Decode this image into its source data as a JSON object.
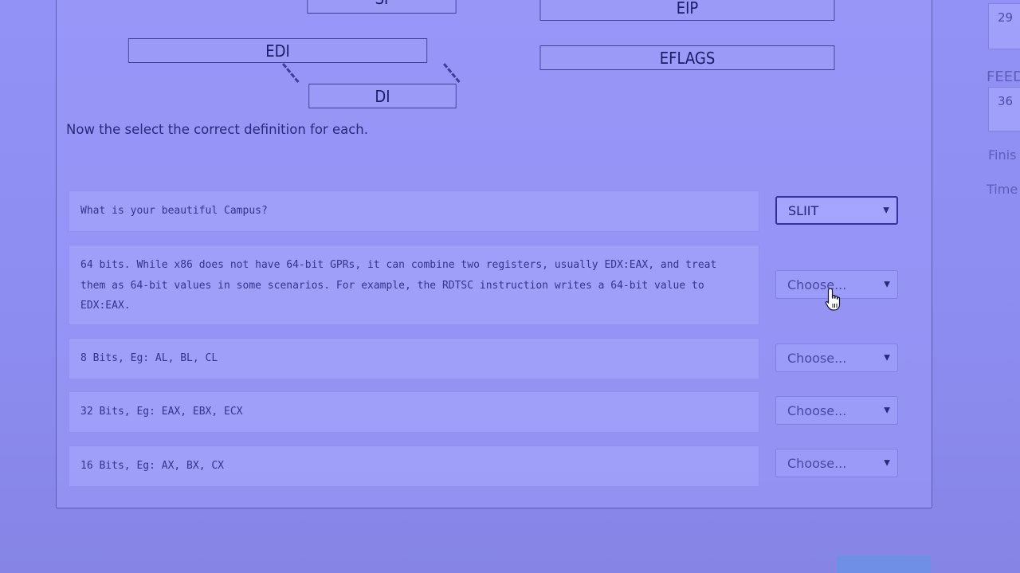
{
  "diagram": {
    "registers": {
      "si": "SI",
      "eip": "EIP",
      "edi": "EDI",
      "eflags": "EFLAGS",
      "di": "DI"
    }
  },
  "instruction": "Now the select the correct definition for each.",
  "questions": [
    {
      "text": "What is your beautiful Campus?",
      "answer": "SLIIT"
    },
    {
      "text": "64 bits. While x86 does not have 64-bit GPRs, it can combine two registers, usually EDX:EAX, and treat them as 64-bit values in some scenarios. For example, the RDTSC instruction writes a 64-bit value to EDX:EAX.",
      "answer": "Choose..."
    },
    {
      "text": "8 Bits, Eg: AL, BL, CL",
      "answer": "Choose..."
    },
    {
      "text": "32 Bits, Eg: EAX, EBX, ECX",
      "answer": "Choose..."
    },
    {
      "text": "16 Bits, Eg: AX, BX, CX",
      "answer": "Choose..."
    }
  ],
  "sidebar": {
    "nav_number_1": "29",
    "feedback_label": "FEED",
    "nav_number_2": "36",
    "finish_label": "Finis",
    "time_label": "Time"
  },
  "colors": {
    "background": "#8f8ef3",
    "text": "#2a2a78",
    "border": "#3e3e9a",
    "active_select_border": "#3333a0",
    "button": "#6f8ee6"
  },
  "icons": {
    "dropdown": "caret-down-icon",
    "cursor": "hand-pointer-icon"
  }
}
